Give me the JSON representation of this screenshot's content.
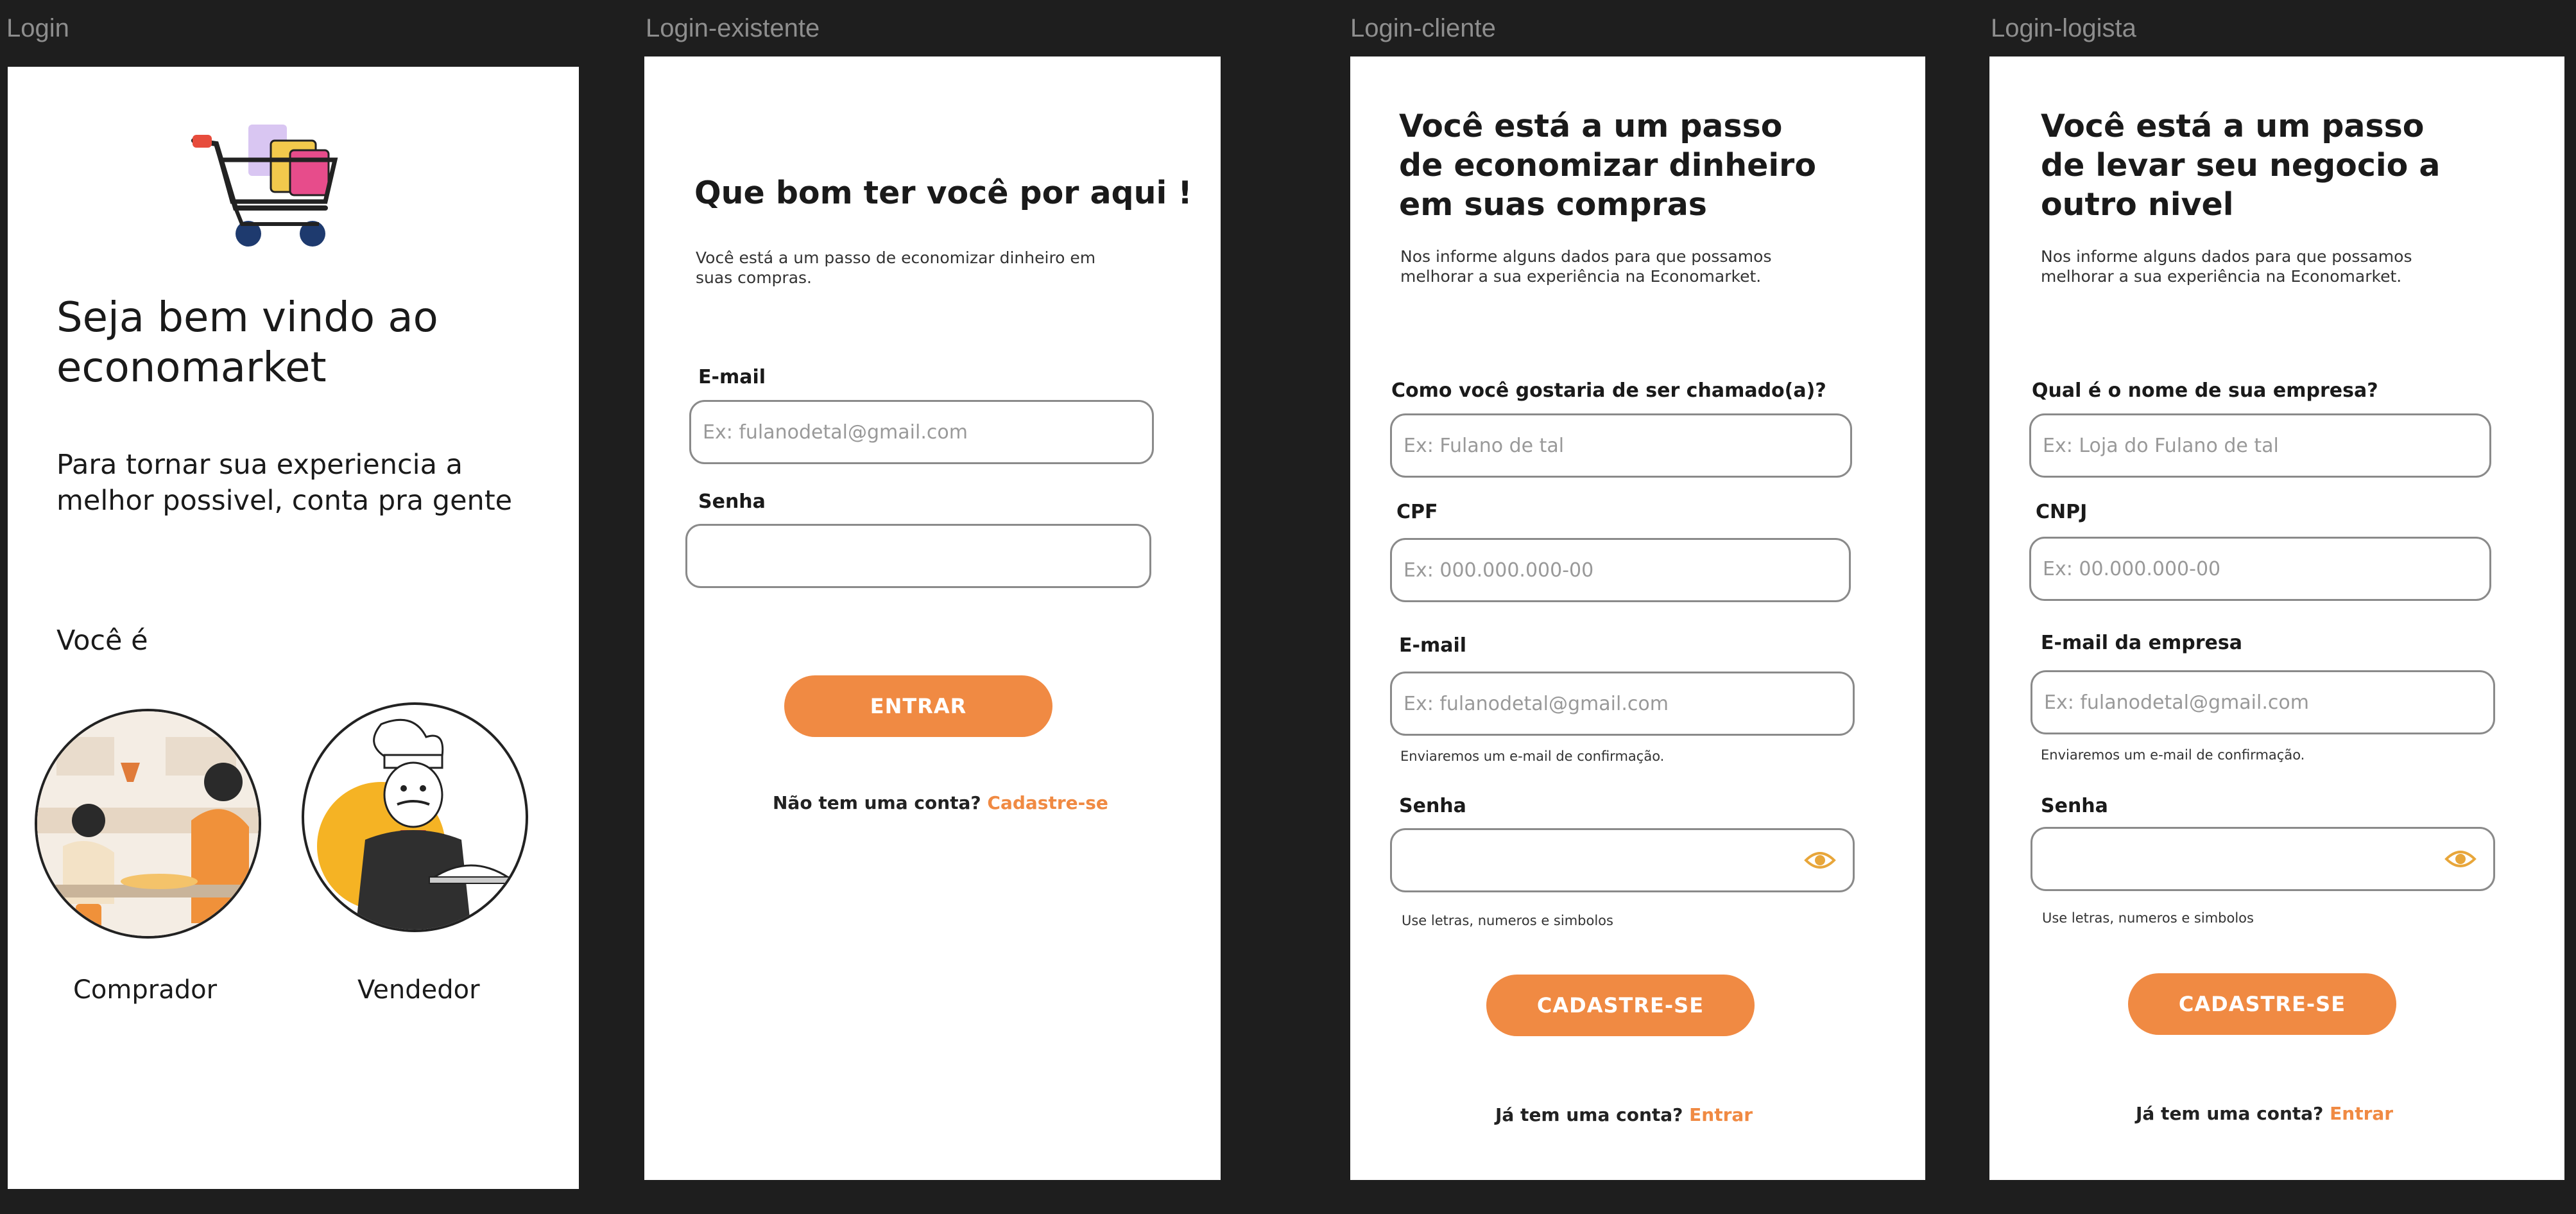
{
  "frames": {
    "login": {
      "label": "Login",
      "title": "Seja bem vindo  ao economarket",
      "subtitle": "Para tornar sua experiencia a melhor possivel, conta pra gente",
      "question": "Você é",
      "option_buyer": "Comprador",
      "option_seller": "Vendedor"
    },
    "login_existente": {
      "label": "Login-existente",
      "title": "Que bom ter você por aqui !",
      "subtitle": "Você está a um passo de economizar dinheiro em suas compras.",
      "email_label": "E-mail",
      "email_placeholder": "Ex: fulanodetal@gmail.com",
      "password_label": "Senha",
      "password_placeholder": "",
      "button": "ENTRAR",
      "footer_text": "Não tem uma conta?",
      "footer_link": "Cadastre-se"
    },
    "login_cliente": {
      "label": "Login-cliente",
      "title": "Você está a um passo de economizar dinheiro em suas compras",
      "subtitle": "Nos informe alguns dados para que possamos melhorar a sua experiência na Economarket.",
      "name_label": "Como você gostaria de ser chamado(a)?",
      "name_placeholder": "Ex: Fulano de tal",
      "cpf_label": "CPF",
      "cpf_placeholder": "Ex: 000.000.000-00",
      "email_label": "E-mail",
      "email_placeholder": "Ex: fulanodetal@gmail.com",
      "email_hint": "Enviaremos um e-mail de confirmação.",
      "password_label": "Senha",
      "password_hint": "Use letras, numeros e simbolos",
      "button": "CADASTRE-SE",
      "footer_text": "Já tem uma conta?",
      "footer_link": "Entrar"
    },
    "login_logista": {
      "label": "Login-logista",
      "title": "Você está a um passo de levar seu negocio a outro nivel",
      "subtitle": "Nos informe alguns dados para que possamos melhorar a sua experiência na Economarket.",
      "company_label": "Qual é o nome de sua empresa?",
      "company_placeholder": "Ex: Loja do Fulano de tal",
      "cnpj_label": "CNPJ",
      "cnpj_placeholder": "Ex: 00.000.000-00",
      "email_label": "E-mail da empresa",
      "email_placeholder": "Ex: fulanodetal@gmail.com",
      "email_hint": "Enviaremos um e-mail de confirmação.",
      "password_label": "Senha",
      "password_hint": "Use letras, numeros e simbolos",
      "button": "CADASTRE-SE",
      "footer_text": "Já tem uma conta?",
      "footer_link": "Entrar"
    }
  },
  "colors": {
    "background": "#1e1e1e",
    "frame": "#ffffff",
    "accent": "#f08a43",
    "label_gray": "#8e8e8e"
  },
  "icons": [
    "shopping-cart-icon",
    "eye-icon",
    "buyer-illustration",
    "seller-illustration"
  ]
}
